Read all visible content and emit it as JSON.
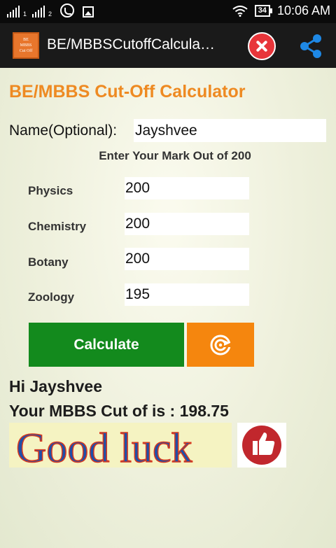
{
  "statusbar": {
    "sim1_sub": "1",
    "sim2_sub": "2",
    "battery": "34",
    "time": "10:06 AM"
  },
  "actionbar": {
    "icon_text": [
      "BE",
      "MBBS",
      "Cut Off"
    ],
    "title": "BE/MBBSCutoffCalcula…"
  },
  "form": {
    "heading": "BE/MBBS Cut-Off Calculator",
    "name_label": "Name(Optional):",
    "name_value": "Jayshvee",
    "instruction": "Enter Your Mark Out of 200",
    "subjects": [
      {
        "label": "Physics",
        "value": "200"
      },
      {
        "label": "Chemistry",
        "value": "200"
      },
      {
        "label": "Botany",
        "value": "200"
      },
      {
        "label": "Zoology",
        "value": "195"
      }
    ],
    "calculate_label": "Calculate"
  },
  "result": {
    "greeting": "Hi Jayshvee",
    "cutoff_text": "Your MBBS Cut of is : 198.75"
  },
  "banner": {
    "text": "Good luck"
  },
  "colors": {
    "accent": "#ee8a22",
    "calculate": "#138a1d",
    "reset": "#f5860e",
    "close": "#e8353a",
    "share": "#1e88e5"
  }
}
